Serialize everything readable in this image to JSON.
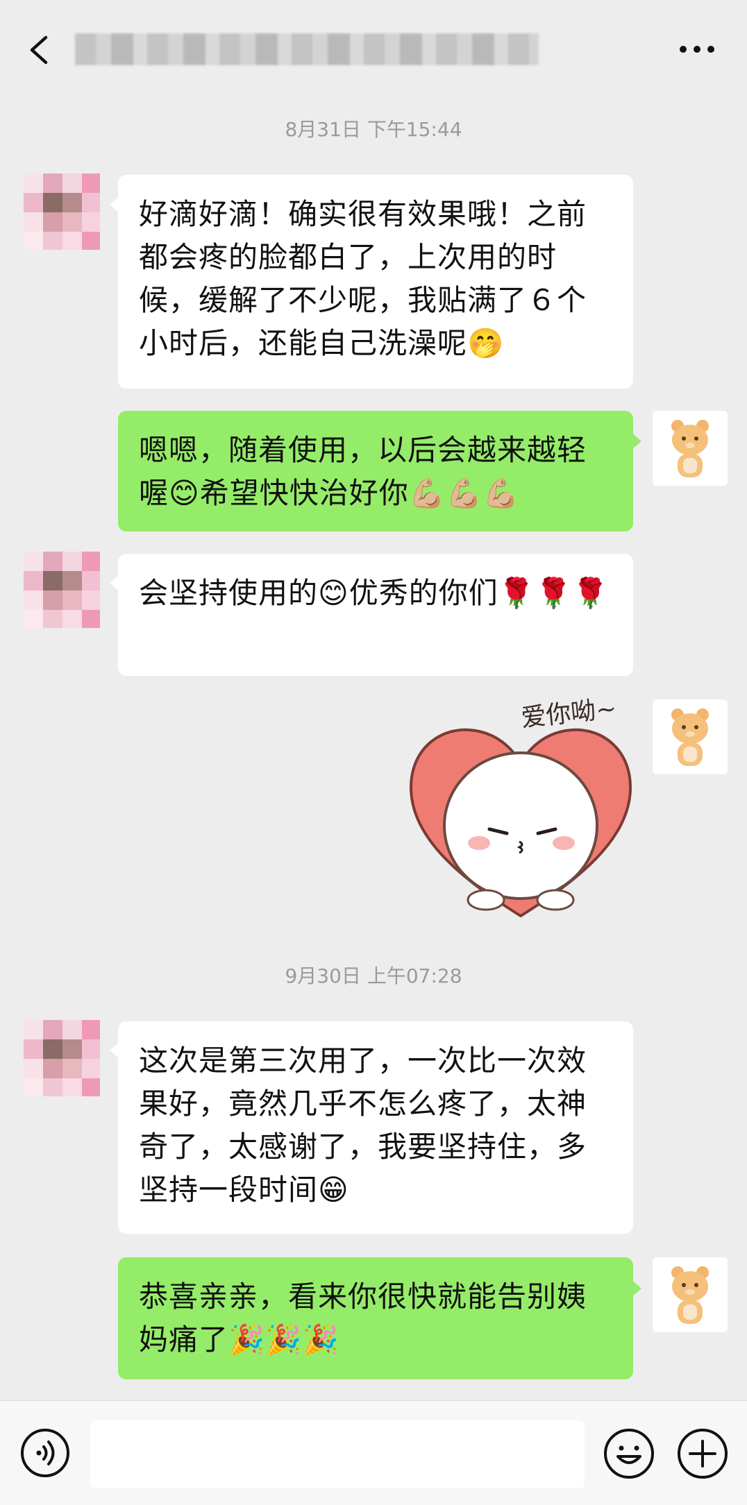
{
  "header": {
    "title_obscured": true
  },
  "messages": [
    {
      "time": "8月31日 下午15:44"
    },
    {
      "side": "left",
      "text": "好滴好滴！确实很有效果哦！之前都会疼的脸都白了，上次用的时候，缓解了不少呢，我贴满了６个小时后，还能自己洗澡呢🤭"
    },
    {
      "side": "right",
      "text": "嗯嗯，随着使用，以后会越来越轻喔😊希望快快治好你💪🏼💪🏼💪🏼"
    },
    {
      "side": "left",
      "text": "会坚持使用的😊优秀的你们🌹🌹🌹"
    },
    {
      "side": "right",
      "sticker_caption": "爱你呦~"
    },
    {
      "time": "9月30日 上午07:28"
    },
    {
      "side": "left",
      "text": "这次是第三次用了，一次比一次效果好，竟然几乎不怎么疼了，太神奇了，太感谢了，我要坚持住，多坚持一段时间😁"
    },
    {
      "side": "right",
      "text": "恭喜亲亲，看来你很快就能告别姨妈痛了🎉🎉🎉"
    }
  ],
  "input": {
    "value": ""
  },
  "icons": {
    "back": "chevron-left-icon",
    "more": "more-icon",
    "voice": "voice-icon",
    "emoji": "emoji-icon",
    "plus": "plus-icon"
  },
  "colors": {
    "background": "#ededed",
    "self_bubble": "#95ec69",
    "other_bubble": "#ffffff",
    "timestamp": "#9a9a9a"
  }
}
